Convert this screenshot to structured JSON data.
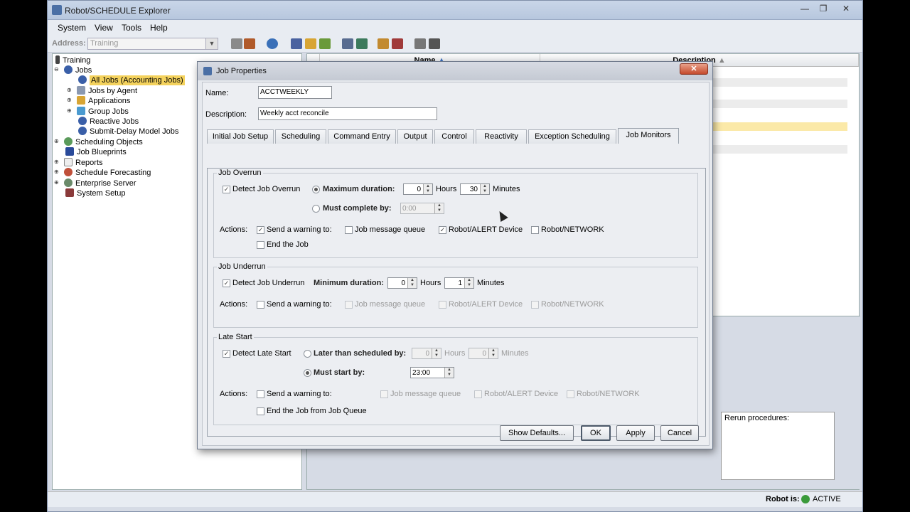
{
  "window": {
    "title": "Robot/SCHEDULE Explorer",
    "min": "—",
    "max": "❐",
    "close": "✕"
  },
  "menu": {
    "system": "System",
    "view": "View",
    "tools": "Tools",
    "help": "Help"
  },
  "toolbar": {
    "address_label": "Address:",
    "address_value": "Training"
  },
  "tree": {
    "root": "Training",
    "jobs": "Jobs",
    "all_jobs": "All Jobs (Accounting Jobs)",
    "jobs_by_agent": "Jobs by Agent",
    "applications": "Applications",
    "group_jobs": "Group Jobs",
    "reactive_jobs": "Reactive Jobs",
    "submit_delay": "Submit-Delay Model Jobs",
    "scheduling_objects": "Scheduling Objects",
    "job_blueprints": "Job Blueprints",
    "reports": "Reports",
    "schedule_forecasting": "Schedule Forecasting",
    "enterprise_server": "Enterprise Server",
    "system_setup": "System Setup"
  },
  "list": {
    "col_name": "Name",
    "col_description": "Description",
    "rerun_label": "Rerun procedures:"
  },
  "status": {
    "label": "Robot is:",
    "value": "ACTIVE"
  },
  "dialog": {
    "title": "Job Properties",
    "close": "✕",
    "name_label": "Name:",
    "name_value": "ACCTWEEKLY",
    "desc_label": "Description:",
    "desc_value": "Weekly acct reconcile",
    "tabs": [
      "Initial Job Setup",
      "Scheduling",
      "Command Entry",
      "Output",
      "Control",
      "Reactivity",
      "Exception Scheduling",
      "Job Monitors"
    ],
    "overrun": {
      "title": "Job Overrun",
      "detect": "Detect Job Overrun",
      "max_duration": "Maximum duration:",
      "hours_value": "0",
      "hours": "Hours",
      "minutes_value": "30",
      "minutes": "Minutes",
      "must_complete": "Must complete by:",
      "complete_time": "0:00",
      "actions": "Actions:",
      "send_warning": "Send a warning to:",
      "job_msg_queue": "Job message queue",
      "robot_alert": "Robot/ALERT Device",
      "robot_network": "Robot/NETWORK",
      "end_job": "End the Job"
    },
    "underrun": {
      "title": "Job Underrun",
      "detect": "Detect Job Underrun",
      "min_duration": "Minimum duration:",
      "hours_value": "0",
      "hours": "Hours",
      "minutes_value": "1",
      "minutes": "Minutes",
      "actions": "Actions:",
      "send_warning": "Send a warning to:",
      "job_msg_queue": "Job message queue",
      "robot_alert": "Robot/ALERT Device",
      "robot_network": "Robot/NETWORK"
    },
    "late": {
      "title": "Late Start",
      "detect": "Detect Late Start",
      "later_than": "Later than scheduled by:",
      "hours_value": "0",
      "hours": "Hours",
      "minutes_value": "0",
      "minutes": "Minutes",
      "must_start": "Must start by:",
      "start_time": "23:00",
      "actions": "Actions:",
      "send_warning": "Send a warning to:",
      "job_msg_queue": "Job message queue",
      "robot_alert": "Robot/ALERT Device",
      "robot_network": "Robot/NETWORK",
      "end_job_queue": "End the Job from Job Queue"
    },
    "buttons": {
      "show_defaults": "Show Defaults...",
      "ok": "OK",
      "apply": "Apply",
      "cancel": "Cancel"
    }
  },
  "colors": {
    "selection": "#f4d25d",
    "close_button": "#c44a2c",
    "active_icon": "#3a9a3a"
  }
}
